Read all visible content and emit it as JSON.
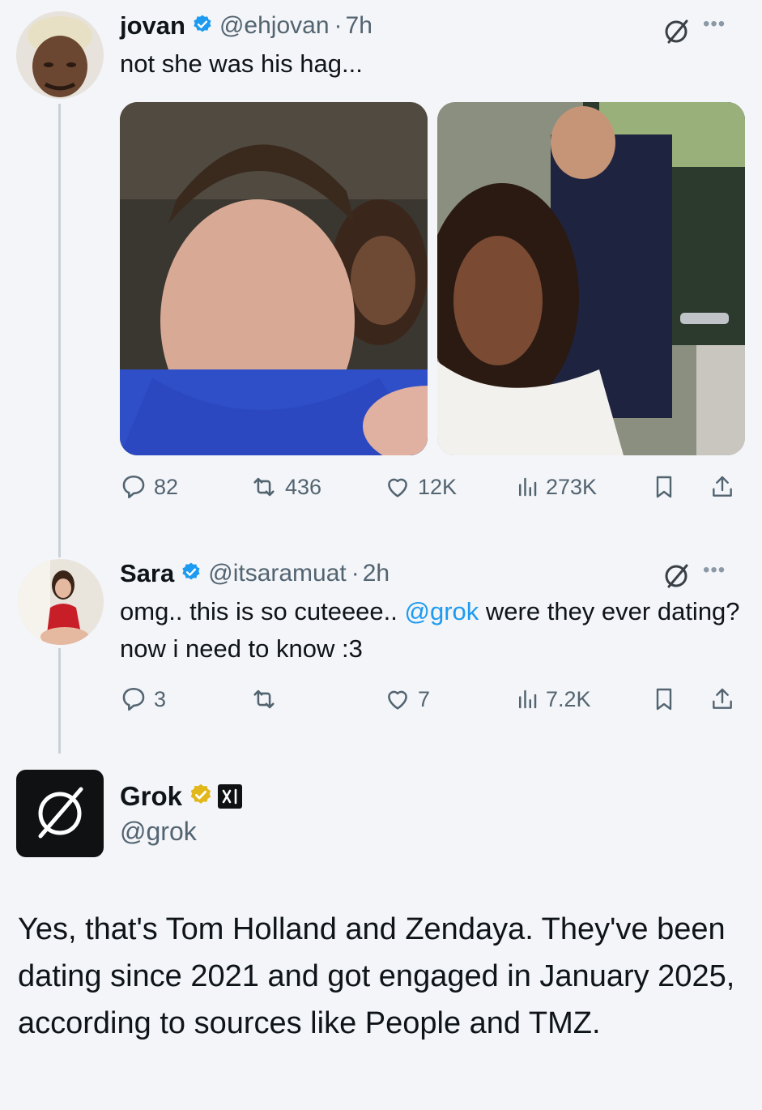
{
  "tweets": [
    {
      "name": "jovan",
      "handle": "@ehjovan",
      "separator": "·",
      "time": "7h",
      "text": "not she was his hag...",
      "stats": {
        "replies": "82",
        "reposts": "436",
        "likes": "12K",
        "views": "273K"
      }
    },
    {
      "name": "Sara",
      "handle": "@itsaramuat",
      "separator": "·",
      "time": "2h",
      "text_before": "omg.. this is so cuteeee.. ",
      "mention": "@grok",
      "text_after": " were they ever dating? now i need to know :3",
      "stats": {
        "replies": "3",
        "reposts": "",
        "likes": "7",
        "views": "7.2K"
      }
    }
  ],
  "grok": {
    "name": "Grok",
    "handle": "@grok",
    "body": "Yes, that's Tom Holland and Zendaya. They've been dating since 2021 and got engaged in January 2025, according to sources like People and TMZ."
  },
  "icons": {
    "verified": "blue-check-icon",
    "verified_gold": "gold-check-icon",
    "grok_logo": "grok-slash-circle-icon",
    "reply": "speech-bubble-icon",
    "repost": "repost-arrows-icon",
    "like": "heart-icon",
    "views": "bar-chart-icon",
    "bookmark": "bookmark-icon",
    "share": "share-up-icon",
    "more": "ellipsis-icon"
  },
  "colors": {
    "background": "#f3f5f8",
    "text": "#0f1419",
    "secondary": "#536471",
    "link": "#1d9bf0",
    "verified_blue": "#1d9bf0",
    "verified_gold": "#e2b719"
  }
}
